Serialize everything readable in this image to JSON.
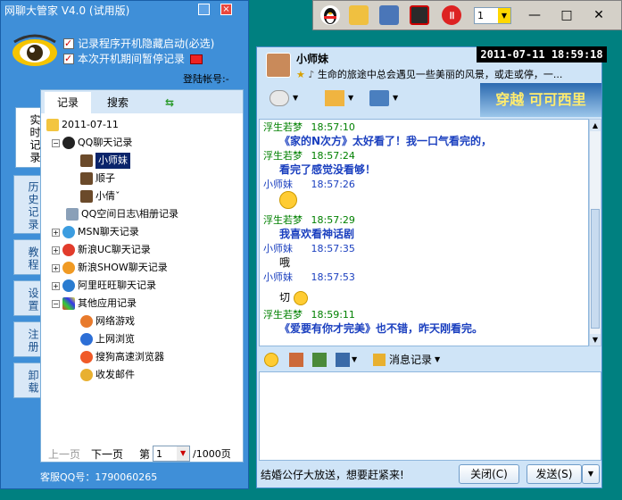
{
  "app": {
    "title": "网聊大管家 V4.0 (试用版)",
    "options": [
      "记录程序开机隐藏启动(必选)",
      "本次开机期间暂停记录"
    ],
    "login_label": "登陆帐号:-",
    "vertical_tabs": [
      "实时记录",
      "历史记录",
      "教程",
      "设置",
      "注册",
      "卸载"
    ],
    "tabs": [
      "记录",
      "搜索",
      "⇆"
    ],
    "tree": {
      "date": "2011-07-11",
      "qq_label": "QQ聊天记录",
      "qq_children": [
        "小师妹",
        "顺子",
        "小倩ˇ"
      ],
      "others": [
        "QQ空间日志\\相册记录",
        "MSN聊天记录",
        "新浪UC聊天记录",
        "新浪SHOW聊天记录",
        "阿里旺旺聊天记录",
        "其他应用记录"
      ],
      "other_children": [
        "网络游戏",
        "上网浏览",
        "搜狗高速浏览器",
        "收发邮件"
      ]
    },
    "pager": {
      "prev": "上一页",
      "next": "下一页",
      "page_label": "第",
      "page_value": "1",
      "total": "/1000页"
    },
    "kefu": "客服QQ号：1790060265"
  },
  "topbar": {
    "select_value": "1"
  },
  "chat": {
    "name": "小师妹",
    "signature": "生命的旅途中总会遇见一些美丽的风景，或走或停，一...",
    "datetime": "2011-07-11    18:59:18",
    "banner": "穿越 可可西里",
    "messages": [
      {
        "who": "浮生若梦",
        "time": "18:57:10",
        "body": ""
      },
      {
        "who": "",
        "time": "",
        "body": "《家的N次方》太好看了！我一口气看完的，"
      },
      {
        "who": "浮生若梦",
        "time": "18:57:24",
        "body": "看完了感觉没看够！"
      },
      {
        "who": "小师妹",
        "time": "18:57:26",
        "body": ""
      },
      {
        "who": "浮生若梦",
        "time": "18:57:29",
        "body": "我喜欢看神话剧"
      },
      {
        "who": "小师妹",
        "time": "18:57:35",
        "body": "哦"
      },
      {
        "who": "小师妹",
        "time": "18:57:53",
        "body": "切"
      },
      {
        "who": "浮生若梦",
        "time": "18:59:11",
        "body": "《爱要有你才完美》也不错，昨天刚看完。"
      }
    ],
    "history_label": "消息记录",
    "ad_text": "结婚公仔大放送，想要赶紧来!",
    "close_label": "关闭(C)",
    "send_label": "发送(S)"
  }
}
